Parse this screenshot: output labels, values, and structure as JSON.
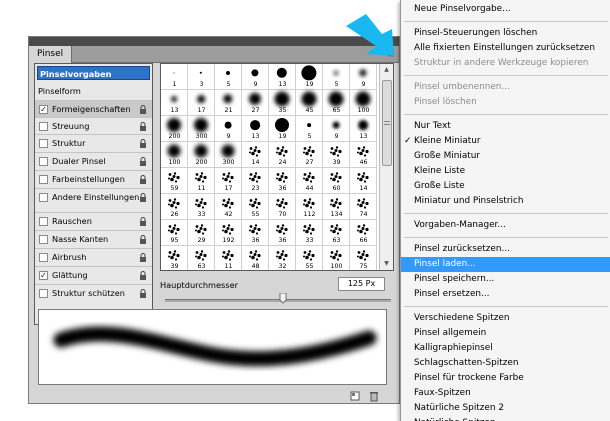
{
  "panel": {
    "tab": "Pinsel",
    "close_glyph": "×"
  },
  "sidebar": {
    "presets_label": "Pinselvorgaben",
    "header": "Pinselform",
    "items": [
      {
        "label": "Formeigenschaften",
        "checked": true,
        "lock": true
      },
      {
        "label": "Streuung",
        "checked": false,
        "lock": true
      },
      {
        "label": "Struktur",
        "checked": false,
        "lock": true
      },
      {
        "label": "Dualer Pinsel",
        "checked": false,
        "lock": true
      },
      {
        "label": "Farbeinstellungen",
        "checked": false,
        "lock": true
      },
      {
        "label": "Andere Einstellungen",
        "checked": false,
        "lock": true
      },
      {
        "label": "Rauschen",
        "checked": false,
        "lock": true
      },
      {
        "label": "Nasse Kanten",
        "checked": false,
        "lock": true
      },
      {
        "label": "Airbrush",
        "checked": false,
        "lock": true
      },
      {
        "label": "Glättung",
        "checked": true,
        "lock": true
      },
      {
        "label": "Struktur schützen",
        "checked": false,
        "lock": true
      }
    ]
  },
  "grid": {
    "rows": [
      [
        "1",
        "3",
        "5",
        "9",
        "13",
        "19",
        "5",
        "9"
      ],
      [
        "13",
        "17",
        "21",
        "27",
        "35",
        "45",
        "65",
        "100"
      ],
      [
        "200",
        "300",
        "9",
        "13",
        "19",
        "5",
        "9",
        "13"
      ],
      [
        "100",
        "200",
        "300",
        "14",
        "24",
        "27",
        "39",
        "46"
      ],
      [
        "59",
        "11",
        "17",
        "23",
        "36",
        "44",
        "60",
        "14"
      ],
      [
        "26",
        "33",
        "42",
        "55",
        "70",
        "112",
        "134",
        "74"
      ],
      [
        "95",
        "29",
        "192",
        "36",
        "36",
        "33",
        "63",
        "66"
      ],
      [
        "39",
        "63",
        "11",
        "48",
        "32",
        "55",
        "100",
        "75"
      ]
    ]
  },
  "diameter": {
    "label": "Hauptdurchmesser",
    "value": "125 Px",
    "fraction": 0.52
  },
  "menu": {
    "items": [
      {
        "label": "Neue Pinselvorgabe...",
        "state": "normal"
      },
      {
        "sep": true
      },
      {
        "label": "Pinsel-Steuerungen löschen",
        "state": "normal"
      },
      {
        "label": "Alle fixierten Einstellungen zurücksetzen",
        "state": "normal"
      },
      {
        "label": "Struktur in andere Werkzeuge kopieren",
        "state": "disabled"
      },
      {
        "sep": true
      },
      {
        "label": "Pinsel umbenennen...",
        "state": "disabled"
      },
      {
        "label": "Pinsel löschen",
        "state": "disabled"
      },
      {
        "sep": true
      },
      {
        "label": "Nur Text",
        "state": "normal"
      },
      {
        "label": "Kleine Miniatur",
        "state": "checked"
      },
      {
        "label": "Große Miniatur",
        "state": "normal"
      },
      {
        "label": "Kleine Liste",
        "state": "normal"
      },
      {
        "label": "Große Liste",
        "state": "normal"
      },
      {
        "label": "Miniatur und Pinselstrich",
        "state": "normal"
      },
      {
        "sep": true
      },
      {
        "label": "Vorgaben-Manager...",
        "state": "normal"
      },
      {
        "sep": true
      },
      {
        "label": "Pinsel zurücksetzen...",
        "state": "normal"
      },
      {
        "label": "Pinsel laden...",
        "state": "highlight"
      },
      {
        "label": "Pinsel speichern...",
        "state": "normal"
      },
      {
        "label": "Pinsel ersetzen...",
        "state": "normal"
      },
      {
        "sep": true
      },
      {
        "label": "Verschiedene Spitzen",
        "state": "normal"
      },
      {
        "label": "Pinsel allgemein",
        "state": "normal"
      },
      {
        "label": "Kalligraphiepinsel",
        "state": "normal"
      },
      {
        "label": "Schlagschatten-Spitzen",
        "state": "normal"
      },
      {
        "label": "Pinsel für trockene Farbe",
        "state": "normal"
      },
      {
        "label": "Faux-Spitzen",
        "state": "normal"
      },
      {
        "label": "Natürliche Spitzen 2",
        "state": "normal"
      },
      {
        "label": "Natürliche Spitzen",
        "state": "normal"
      }
    ]
  },
  "colors": {
    "highlight": "#3399ff",
    "presets_selected": "#2f73c8",
    "arrow": "#1ab8f0"
  }
}
